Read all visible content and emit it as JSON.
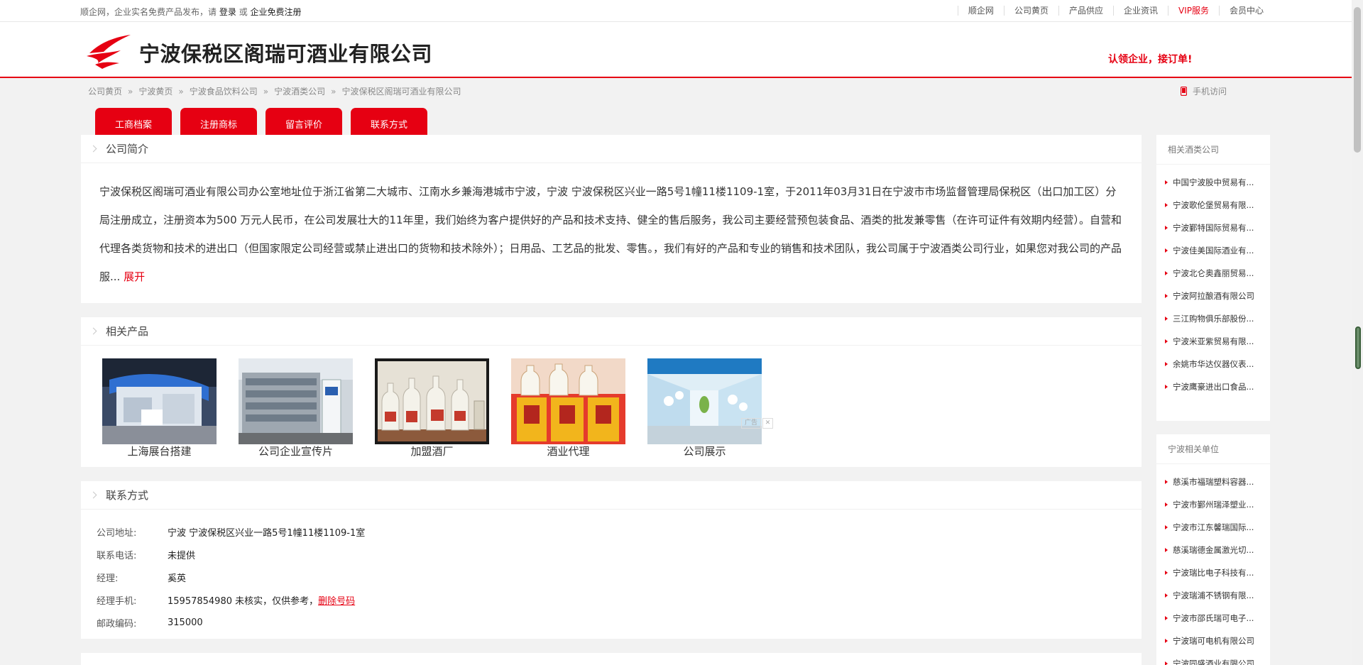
{
  "topbar": {
    "left_text": "顺企网，企业实名免费产品发布，请",
    "login": "登录",
    "or": "或",
    "register": "企业免费注册",
    "nav": [
      "顺企网",
      "公司黄页",
      "产品供应",
      "企业资讯",
      "VIP服务",
      "会员中心"
    ]
  },
  "header": {
    "company_name": "宁波保税区阁瑞可酒业有限公司",
    "slogan": "认领企业，接订单!"
  },
  "breadcrumb": {
    "sep": "»",
    "items": [
      "公司黄页",
      "宁波黄页",
      "宁波食品饮料公司",
      "宁波酒类公司",
      "宁波保税区阁瑞可酒业有限公司"
    ]
  },
  "mobile_label": "手机访问",
  "tabs": [
    "工商档案",
    "注册商标",
    "留言评价",
    "联系方式"
  ],
  "intro": {
    "title": "公司简介",
    "text": "宁波保税区阁瑞可酒业有限公司办公室地址位于浙江省第二大城市、江南水乡兼海港城市宁波，宁波 宁波保税区兴业一路5号1幢11楼1109-1室，于2011年03月31日在宁波市市场监督管理局保税区（出口加工区）分局注册成立，注册资本为500 万元人民币，在公司发展壮大的11年里，我们始终为客户提供好的产品和技术支持、健全的售后服务，我公司主要经营预包装食品、酒类的批发兼零售（在许可证件有效期内经营）。自营和代理各类货物和技术的进出口（但国家限定公司经营或禁止进出口的货物和技术除外）；日用品、工艺品的批发、零售。，我们有好的产品和专业的销售和技术团队，我公司属于宁波酒类公司行业，如果您对我公司的产品服...",
    "more": "展开"
  },
  "products": {
    "title": "相关产品",
    "items": [
      {
        "name": "上海展台搭建",
        "icon": "exhibition-booth-image"
      },
      {
        "name": "公司企业宣传片",
        "icon": "office-building-image"
      },
      {
        "name": "加盟酒厂",
        "icon": "liquor-bottles-image"
      },
      {
        "name": "酒业代理",
        "icon": "liquor-giftbox-image"
      },
      {
        "name": "公司展示",
        "icon": "showroom-image"
      }
    ],
    "ad_label": "广告",
    "ad_close": "✕"
  },
  "contact": {
    "title": "联系方式",
    "rows": [
      {
        "label": "公司地址:",
        "value": "宁波 宁波保税区兴业一路5号1幢11楼1109-1室"
      },
      {
        "label": "联系电话:",
        "value": "未提供"
      },
      {
        "label": "经理:",
        "value": "奚英"
      },
      {
        "label": "经理手机:",
        "value": "15957854980 未核实，仅供参考，"
      },
      {
        "label": "邮政编码:",
        "value": "315000"
      }
    ],
    "delete_link": "删除号码"
  },
  "sidebar_related": {
    "title": "相关酒类公司",
    "items": [
      "中国宁波股中贸易有...",
      "宁波歌伦堡贸易有限...",
      "宁波鄞特国际贸易有...",
      "宁波佳美国际酒业有...",
      "宁波北仑奥鑫丽贸易...",
      "宁波阿拉酿酒有限公司",
      "三江购物俱乐部股份...",
      "宁波米亚紫贸易有限...",
      "余姚市华达仪器仪表...",
      "宁波鹰豪进出口食品..."
    ]
  },
  "sidebar_units": {
    "title": "宁波相关单位",
    "items": [
      "慈溪市福瑞塑料容器...",
      "宁波市鄞州瑞泽塑业...",
      "宁波市江东馨瑞国际...",
      "慈溪瑞德金属激光切...",
      "宁波瑞比电子科技有...",
      "宁波瑞浦不锈钢有限...",
      "宁波市邵氏瑞可电子...",
      "宁波瑞可电机有限公司",
      "宁波同盛酒业有限公司"
    ]
  },
  "colors": {
    "accent": "#e60012"
  }
}
